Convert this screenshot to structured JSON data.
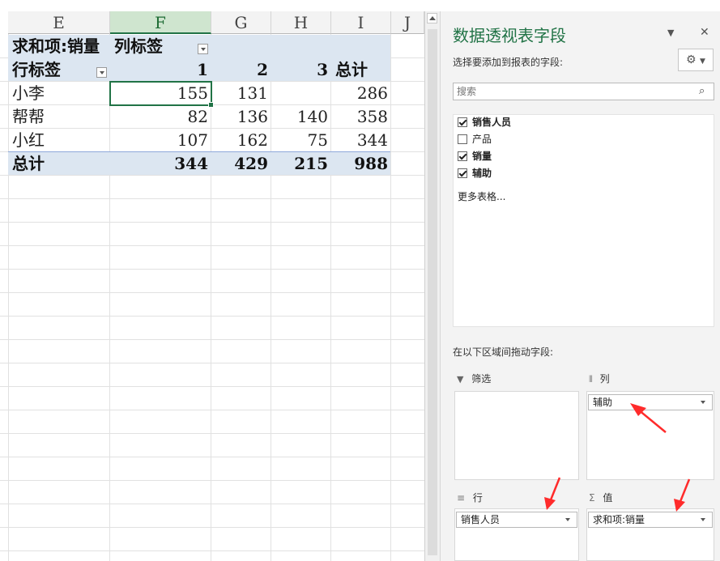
{
  "sheet": {
    "columns": [
      "E",
      "F",
      "G",
      "H",
      "I",
      "J"
    ],
    "selected_column": "F",
    "pivot": {
      "value_field": "求和项:销量",
      "col_label": "列标签",
      "row_label": "行标签",
      "col_headers": [
        "1",
        "2",
        "3"
      ],
      "total_label": "总计",
      "rows": [
        {
          "name": "小李",
          "values": [
            "155",
            "131",
            "",
            "286"
          ]
        },
        {
          "name": "帮帮",
          "values": [
            "82",
            "136",
            "140",
            "358"
          ]
        },
        {
          "name": "小红",
          "values": [
            "107",
            "162",
            "75",
            "344"
          ]
        }
      ],
      "grand_total": {
        "name": "总计",
        "values": [
          "344",
          "429",
          "215",
          "988"
        ]
      }
    }
  },
  "pane": {
    "title": "数据透视表字段",
    "subtitle": "选择要添加到报表的字段:",
    "search_placeholder": "搜索",
    "fields": [
      {
        "label": "销售人员",
        "checked": true
      },
      {
        "label": "产品",
        "checked": false
      },
      {
        "label": "销量",
        "checked": true
      },
      {
        "label": "辅助",
        "checked": true
      }
    ],
    "more_tables": "更多表格...",
    "drag_hint": "在以下区域间拖动字段:",
    "areas": {
      "filter": {
        "label": "筛选"
      },
      "columns": {
        "label": "列",
        "item": "辅助"
      },
      "rows": {
        "label": "行",
        "item": "销售人员"
      },
      "values": {
        "label": "值",
        "item": "求和项:销量"
      }
    },
    "icons": {
      "filter": "funnel-icon",
      "columns": "column-bars-icon",
      "rows": "row-lines-icon",
      "values": "sigma-icon"
    },
    "accent_color": "#217346",
    "annotation_color": "#ff2b2b"
  }
}
